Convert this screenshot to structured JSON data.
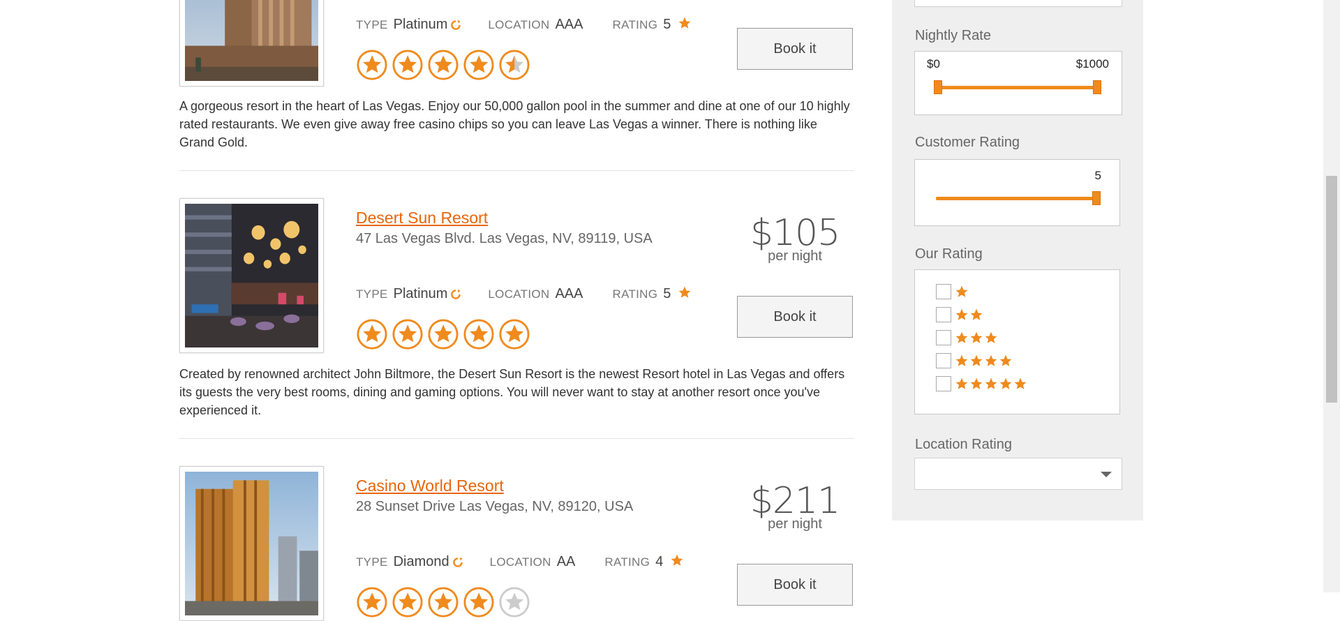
{
  "listings": [
    {
      "name": "",
      "address": "",
      "price": "",
      "per_night": "",
      "type_label": "TYPE",
      "type_value": "Platinum",
      "location_label": "LOCATION",
      "location_value": "AAA",
      "rating_label": "RATING",
      "rating_value": "5",
      "star_score": 4.5,
      "book_label": "Book it",
      "description": "A gorgeous resort in the heart of Las Vegas. Enjoy our 50,000 gallon pool in the summer and dine at one of our 10 highly rated restaurants. We even give away free casino chips so you can leave Las Vegas a winner. There is nothing like Grand Gold."
    },
    {
      "name": "Desert Sun Resort",
      "address": "47 Las Vegas Blvd. Las Vegas, NV, 89119, USA",
      "price": "$105",
      "per_night": "per night",
      "type_label": "TYPE",
      "type_value": "Platinum",
      "location_label": "LOCATION",
      "location_value": "AAA",
      "rating_label": "RATING",
      "rating_value": "5",
      "star_score": 5,
      "book_label": "Book it",
      "description": "Created by renowned architect John Biltmore, the Desert Sun Resort is the newest Resort hotel in Las Vegas and offers its guests the very best rooms, dining and gaming options. You will never want to stay at another resort once you've experienced it."
    },
    {
      "name": "Casino World Resort",
      "address": "28 Sunset Drive Las Vegas, NV, 89120, USA",
      "price": "$211",
      "per_night": "per night",
      "type_label": "TYPE",
      "type_value": "Diamond",
      "location_label": "LOCATION",
      "location_value": "AA",
      "rating_label": "RATING",
      "rating_value": "4",
      "star_score": 4,
      "book_label": "Book it",
      "description": ""
    }
  ],
  "sidebar": {
    "nightly_rate": {
      "label": "Nightly Rate",
      "min_text": "$0",
      "max_text": "$1000",
      "low_fraction": 0.0,
      "high_fraction": 1.0
    },
    "customer_rating": {
      "label": "Customer Rating",
      "value_text": "5",
      "fraction": 1.0
    },
    "our_rating": {
      "label": "Our Rating",
      "options": [
        1,
        2,
        3,
        4,
        5
      ]
    },
    "location_rating": {
      "label": "Location Rating",
      "selected": ""
    }
  },
  "colors": {
    "accent": "#f08a1c",
    "link": "#e8650a"
  },
  "icons": {
    "refresh": "refresh-icon",
    "star": "star-icon",
    "caret": "chevron-down-icon"
  }
}
